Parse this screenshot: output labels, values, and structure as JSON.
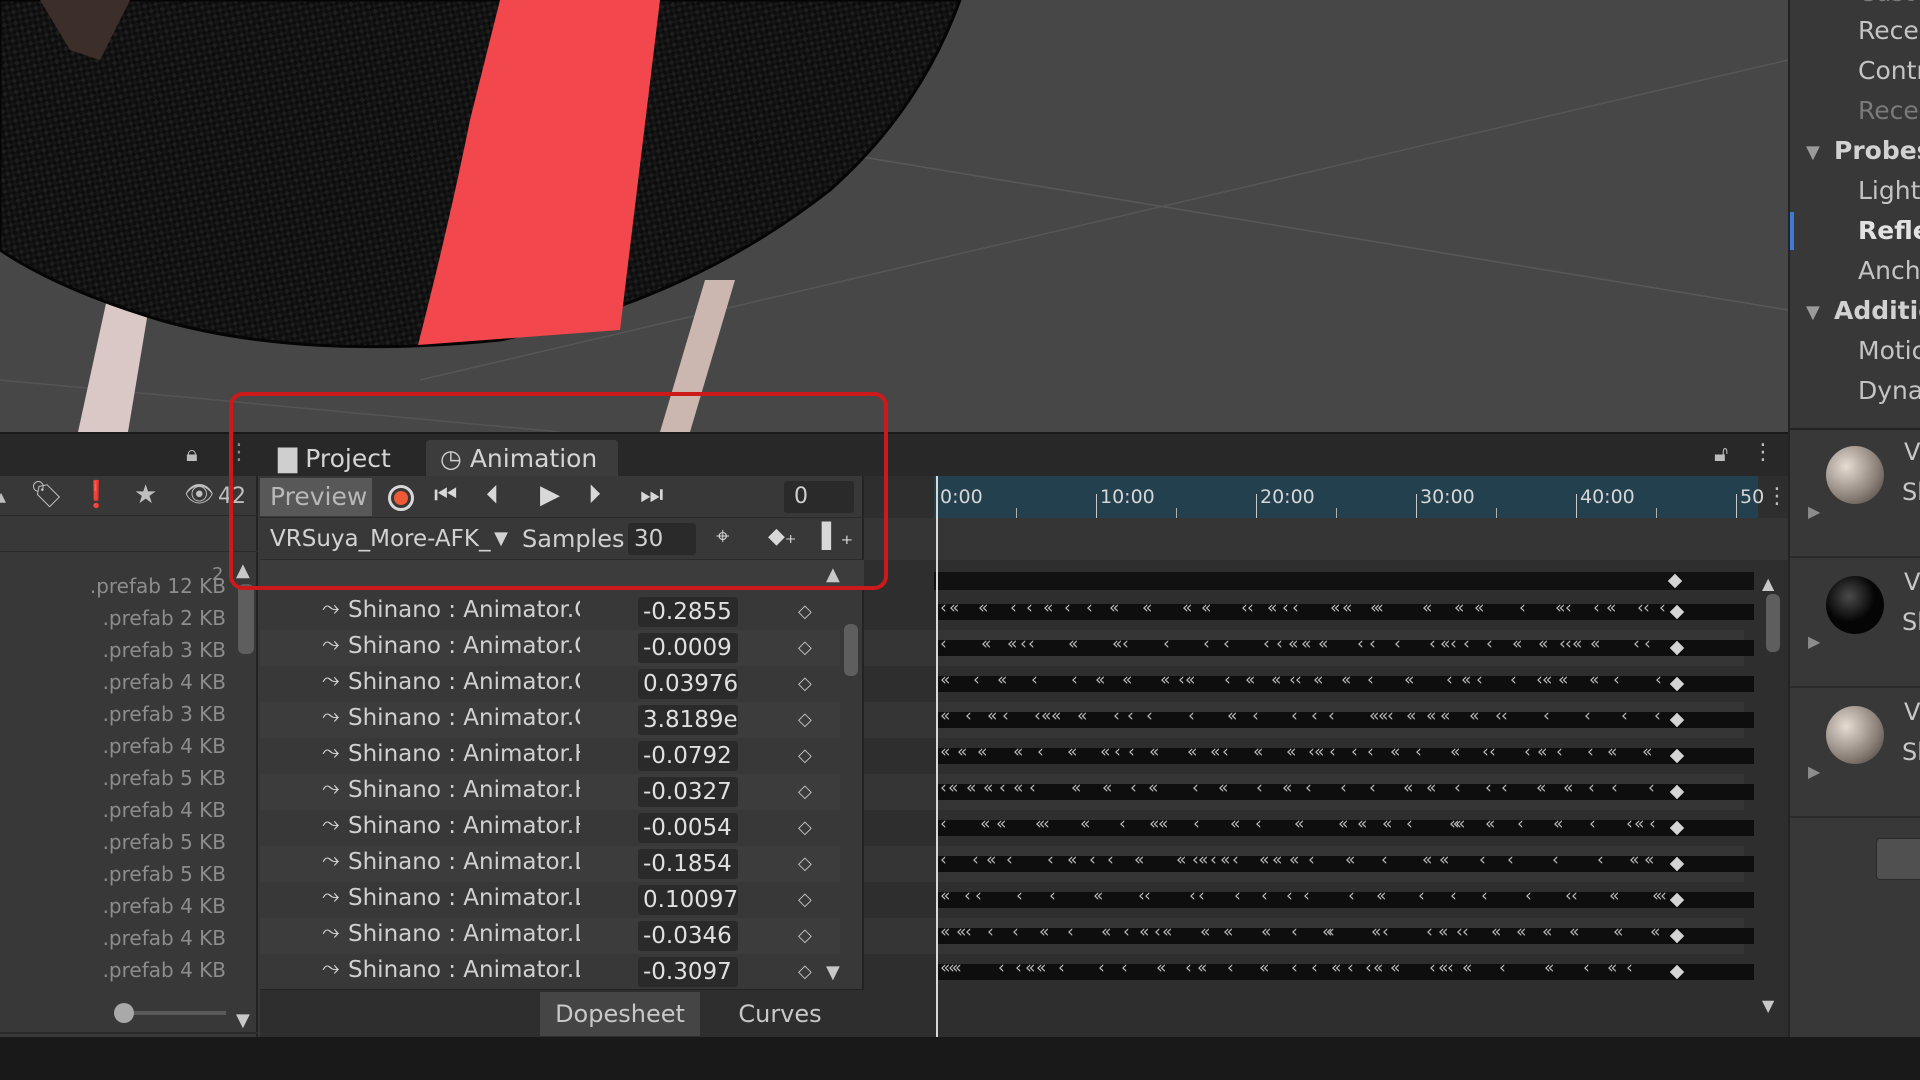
{
  "inspector": {
    "items": [
      {
        "label": "Cust",
        "kind": "dim"
      },
      {
        "label": "Recei",
        "kind": "normal"
      },
      {
        "label": "Contr",
        "kind": "normal"
      },
      {
        "label": "Recei",
        "kind": "dim"
      },
      {
        "label": "Probes",
        "kind": "section"
      },
      {
        "label": "Light",
        "kind": "normal"
      },
      {
        "label": "Refle",
        "kind": "selected"
      },
      {
        "label": "Ancho",
        "kind": "normal"
      },
      {
        "label": "Additio",
        "kind": "section"
      },
      {
        "label": "Motic",
        "kind": "normal"
      },
      {
        "label": "Dyna",
        "kind": "normal"
      }
    ],
    "assets": [
      {
        "letter": "V",
        "sub": "Sh"
      },
      {
        "letter": "V",
        "sub": "Sh"
      },
      {
        "letter": "V",
        "sub": "Sh"
      }
    ]
  },
  "tabs": {
    "project": "Project",
    "animation": "Animation"
  },
  "project": {
    "hidden_count": "42",
    "scroll_index": "2",
    "files": [
      {
        "ext": ".prefab",
        "size": "12 KB"
      },
      {
        "ext": ".prefab",
        "size": "2 KB"
      },
      {
        "ext": ".prefab",
        "size": "3 KB"
      },
      {
        "ext": ".prefab",
        "size": "4 KB"
      },
      {
        "ext": ".prefab",
        "size": "3 KB"
      },
      {
        "ext": ".prefab",
        "size": "4 KB"
      },
      {
        "ext": ".prefab",
        "size": "5 KB"
      },
      {
        "ext": ".prefab",
        "size": "4 KB"
      },
      {
        "ext": ".prefab",
        "size": "5 KB"
      },
      {
        "ext": ".prefab",
        "size": "5 KB"
      },
      {
        "ext": ".prefab",
        "size": "4 KB"
      },
      {
        "ext": ".prefab",
        "size": "4 KB"
      },
      {
        "ext": ".prefab",
        "size": "4 KB"
      }
    ]
  },
  "animation": {
    "preview_label": "Preview",
    "frame": "0",
    "clip_name": "VRSuya_More-AFK_",
    "samples_label": "Samples",
    "samples_value": "30",
    "properties": [
      {
        "name": "Shinano : Animator.Chest",
        "value": "-0.2855"
      },
      {
        "name": "Shinano : Animator.Chest",
        "value": "-0.0009"
      },
      {
        "name": "Shinano : Animator.Chest",
        "value": "0.03976"
      },
      {
        "name": "Shinano : Animator.Chest",
        "value": "3.8189e"
      },
      {
        "name": "Shinano : Animator.Head",
        "value": "-0.0792"
      },
      {
        "name": "Shinano : Animator.Head",
        "value": "-0.0327"
      },
      {
        "name": "Shinano : Animator.Head",
        "value": "-0.0054"
      },
      {
        "name": "Shinano : Animator.Left A",
        "value": "-0.1854"
      },
      {
        "name": "Shinano : Animator.Left A",
        "value": "0.10097"
      },
      {
        "name": "Shinano : Animator.Left A",
        "value": "-0.0346"
      },
      {
        "name": "Shinano : Animator.Left F",
        "value": "-0.3097"
      }
    ],
    "view_tabs": {
      "dopesheet": "Dopesheet",
      "curves": "Curves"
    }
  },
  "timeline": {
    "ticks": [
      "0:00",
      "10:00",
      "20:00",
      "30:00",
      "40:00",
      "50"
    ]
  },
  "colors": {
    "accent_record": "#ee5a35",
    "highlight_box": "#cc1a1a",
    "ruler_bg": "#22404e",
    "selection_bar": "#3d7bd6"
  }
}
